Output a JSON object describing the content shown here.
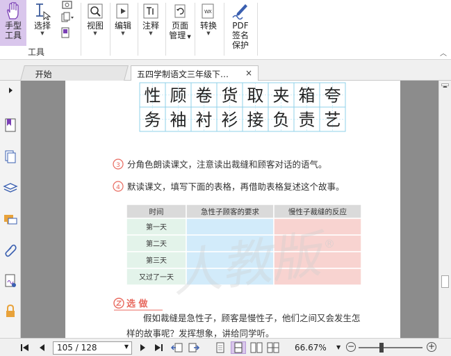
{
  "ribbon": {
    "hand_tool": {
      "line1": "手型",
      "line2": "工具"
    },
    "select": "选择",
    "view": "视图",
    "edit": "编辑",
    "comment": "注释",
    "page_mgmt": {
      "line1": "页面",
      "line2": "管理"
    },
    "convert": "转换",
    "pdf_sign": {
      "line1": "PDF",
      "line2": "签名",
      "line3": "保护"
    },
    "group_tools": "工具"
  },
  "tabs": {
    "start": "开始",
    "doc": "五四学制语文三年级下…",
    "close": "×"
  },
  "document": {
    "chars_row1": [
      "性",
      "顾",
      "卷",
      "货",
      "取",
      "夹",
      "箱",
      "夸"
    ],
    "chars_row2": [
      "务",
      "袖",
      "衬",
      "衫",
      "接",
      "负",
      "责",
      "艺"
    ],
    "item3": "分角色朗读课文，注意读出裁缝和顾客对话的语气。",
    "item4": "默读课文，填写下面的表格，再借助表格复述这个故事。",
    "num3": "3",
    "num4": "4",
    "table": {
      "headers": [
        "时间",
        "急性子顾客的要求",
        "慢性子裁缝的反应"
      ],
      "rows": [
        "第一天",
        "第二天",
        "第三天",
        "又过了一天"
      ]
    },
    "watermark": "人教版",
    "watermark_mark": "®",
    "section_title": "选  做",
    "para_line1": "假如裁缝是急性子，顾客是慢性子，他们之间又会发生怎",
    "para_line2": "样的故事呢？发挥想象，讲给同学听。"
  },
  "status": {
    "page": "105 / 128",
    "zoom": "66.67%"
  },
  "colors": {
    "accent": "#7a3fb5",
    "active_bg": "#d9c6ec",
    "grid_blue": "#8fd1ea",
    "cell_green": "#e3f3ea",
    "cell_blue": "#d2ebfa",
    "cell_pink": "#f8d3d0",
    "header_gray": "#dadada",
    "num_red": "#e86a5f"
  }
}
